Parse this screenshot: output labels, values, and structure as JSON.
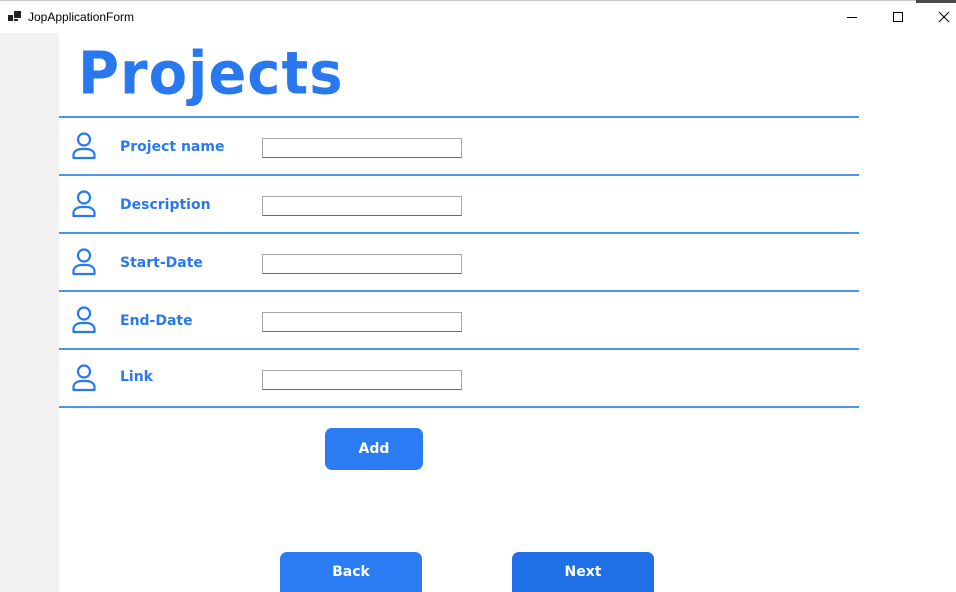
{
  "window": {
    "title": "JopApplicationForm",
    "controls": [
      {
        "name": "minimize",
        "icon": "minimize-icon"
      },
      {
        "name": "maximize",
        "icon": "maximize-icon"
      },
      {
        "name": "close",
        "icon": "close-icon"
      }
    ]
  },
  "page": {
    "heading": "Projects"
  },
  "form": {
    "fields": [
      {
        "label": "Project name",
        "value": "",
        "icon": "user-icon"
      },
      {
        "label": "Description",
        "value": "",
        "icon": "user-icon"
      },
      {
        "label": "Start-Date",
        "value": "",
        "icon": "user-icon"
      },
      {
        "label": "End-Date",
        "value": "",
        "icon": "user-icon"
      },
      {
        "label": "Link",
        "value": "",
        "icon": "user-icon"
      }
    ],
    "add_label": "Add"
  },
  "nav": {
    "back_label": "Back",
    "next_label": "Next"
  },
  "colors": {
    "accent": "#2a78f0",
    "divider": "#4d95ea",
    "button": "#2b7cf3",
    "button_next": "#1f6fe6"
  }
}
